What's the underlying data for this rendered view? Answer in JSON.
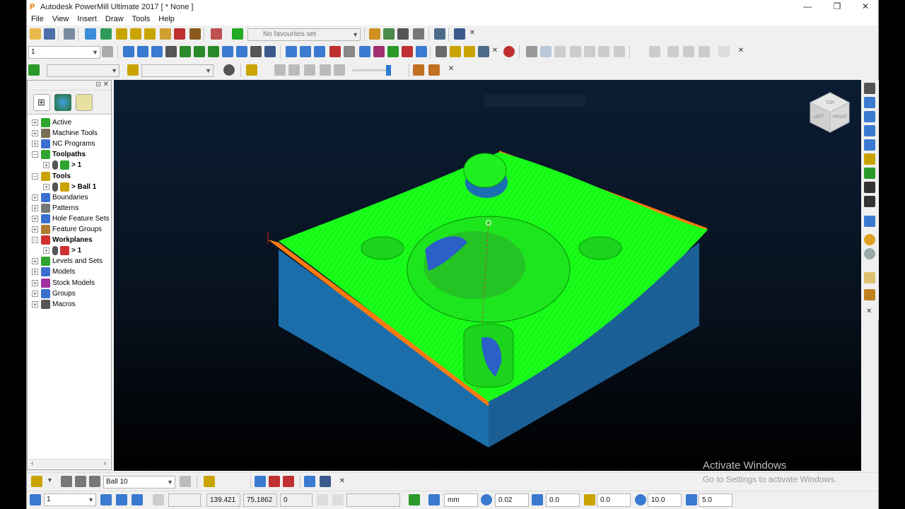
{
  "window": {
    "title": "Autodesk PowerMill Ultimate 2017   [ * None ]",
    "minimize": "—",
    "restore": "❐",
    "close": "✕"
  },
  "menu": [
    "File",
    "View",
    "Insert",
    "Draw",
    "Tools",
    "Help"
  ],
  "toolbar1": {
    "favourites_placeholder": "No favourites set"
  },
  "toolbar2": {
    "workplane_value": "1"
  },
  "explorer": {
    "tree": [
      {
        "label": "Active",
        "bold": false,
        "icon": "active-arrow-icon",
        "color": "#2fa52f"
      },
      {
        "label": "Machine Tools",
        "bold": false,
        "icon": "machine-tool-icon",
        "color": "#7a6e55"
      },
      {
        "label": "NC Programs",
        "bold": false,
        "icon": "nc-program-icon",
        "color": "#3a6fd0"
      },
      {
        "label": "Toolpaths",
        "bold": true,
        "icon": "toolpath-icon",
        "color": "#2fa52f"
      },
      {
        "label": "> 1",
        "bold": true,
        "icon": "toolpath-item-icon",
        "color": "#2fa52f",
        "child": true
      },
      {
        "label": "Tools",
        "bold": true,
        "icon": "tools-icon",
        "color": "#c9a400"
      },
      {
        "label": "> Ball 1",
        "bold": true,
        "icon": "ball-tool-icon",
        "color": "#c9a400",
        "child": true
      },
      {
        "label": "Boundaries",
        "bold": false,
        "icon": "boundary-icon",
        "color": "#3a6fd0"
      },
      {
        "label": "Patterns",
        "bold": false,
        "icon": "pattern-icon",
        "color": "#777777"
      },
      {
        "label": "Hole Feature Sets",
        "bold": false,
        "icon": "hole-feature-icon",
        "color": "#3a6fd0"
      },
      {
        "label": "Feature Groups",
        "bold": false,
        "icon": "feature-group-icon",
        "color": "#b07a30"
      },
      {
        "label": "Workplanes",
        "bold": true,
        "icon": "workplane-icon",
        "color": "#d03030"
      },
      {
        "label": "> 1",
        "bold": true,
        "icon": "workplane-item-icon",
        "color": "#d03030",
        "child": true
      },
      {
        "label": "Levels and Sets",
        "bold": false,
        "icon": "levels-icon",
        "color": "#2fa52f"
      },
      {
        "label": "Models",
        "bold": false,
        "icon": "model-icon",
        "color": "#3a6fd0"
      },
      {
        "label": "Stock Models",
        "bold": false,
        "icon": "stock-model-icon",
        "color": "#a030a0"
      },
      {
        "label": "Groups",
        "bold": false,
        "icon": "groups-icon",
        "color": "#3a6fd0"
      },
      {
        "label": "Macros",
        "bold": false,
        "icon": "macros-icon",
        "color": "#555555"
      }
    ]
  },
  "viewcube": {
    "faces": [
      "TOP",
      "LEFT",
      "FRONT"
    ]
  },
  "bottom_toolbar": {
    "tool_name": "Ball 10"
  },
  "statusbar": {
    "workplane": "1",
    "x": "139.421",
    "y": "75.1862",
    "z": "0",
    "units": "mm",
    "tolerance": "0.02",
    "thickness": "0.0",
    "axial_thickness": "0.0",
    "tool_diameter": "10.0",
    "stepover": "5.0"
  },
  "watermark": {
    "title": "Activate Windows",
    "subtitle": "Go to Settings to activate Windows."
  },
  "colors": {
    "toolpath_green": "#19ff19",
    "stock_blue": "#1c6eaa",
    "edge_orange": "#ff7a10"
  }
}
